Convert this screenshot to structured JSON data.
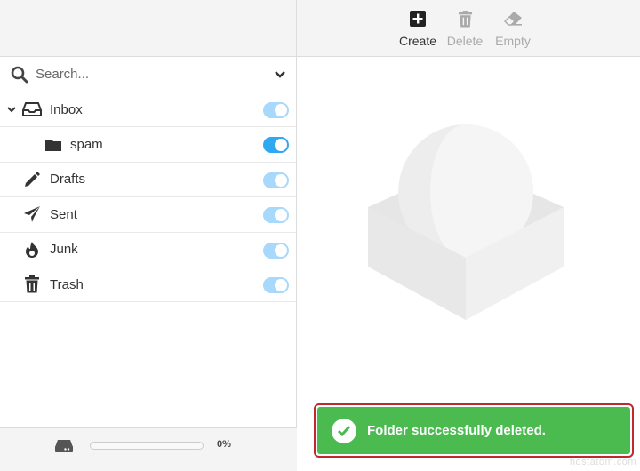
{
  "search": {
    "placeholder": "Search..."
  },
  "folders": [
    {
      "name": "Inbox",
      "icon": "inbox-icon",
      "expanded": true,
      "enabled": true
    },
    {
      "name": "spam",
      "icon": "folder-icon",
      "enabled": true,
      "highlighted": true
    },
    {
      "name": "Drafts",
      "icon": "pencil-icon",
      "enabled": true
    },
    {
      "name": "Sent",
      "icon": "paper-plane-icon",
      "enabled": true
    },
    {
      "name": "Junk",
      "icon": "fire-icon",
      "enabled": true
    },
    {
      "name": "Trash",
      "icon": "trash-icon",
      "enabled": true
    }
  ],
  "toolbar": {
    "create_label": "Create",
    "delete_label": "Delete",
    "empty_label": "Empty"
  },
  "quota": {
    "percent_label": "0%",
    "value": 0
  },
  "notification": {
    "message": "Folder successfully deleted.",
    "color": "#4bbb50"
  },
  "watermark": "hostatom.com",
  "colors": {
    "toggle_on": "#2ea8f1",
    "toggle_light": "#a8d8fb",
    "toast_border": "#c0282d"
  }
}
